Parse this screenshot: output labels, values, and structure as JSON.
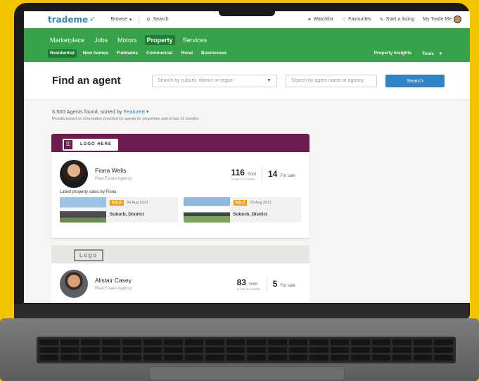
{
  "topbar": {
    "logo": "trademe",
    "browse": "Browse",
    "search": "Search",
    "watchlist": "Watchlist",
    "favourites": "Favourites",
    "start_listing": "Start a listing",
    "my_trademe": "My Trade Me"
  },
  "nav": {
    "main": [
      "Marketplace",
      "Jobs",
      "Motors",
      "Property",
      "Services"
    ],
    "sub": [
      "Residential",
      "New homes",
      "Flatmates",
      "Commercial",
      "Rural",
      "Businesses"
    ],
    "insights": "Property Insights",
    "tools": "Tools"
  },
  "find": {
    "title": "Find an agent",
    "region_placeholder": "Search by suburb, district or region",
    "name_placeholder": "Search by agent name or agency",
    "search_label": "Search"
  },
  "results": {
    "count_text": "6,500 Agents found, sorted by",
    "sort_value": "Featured",
    "note": "Results based on information provided by agents for properties sold in last 12 months."
  },
  "agents": [
    {
      "logo_text": "LOGO HERE",
      "name": "Fiona Wells",
      "agency": "Real Estate Agency",
      "sold": "116",
      "sold_label": "Sold",
      "sold_sub": "in last 12 months",
      "for_sale": "14",
      "for_sale_label": "For sale",
      "latest_label": "Latest property sales by Fiona",
      "sales": [
        {
          "badge": "SOLD",
          "date": "24 Aug 2021",
          "location": "Suburb, District"
        },
        {
          "badge": "SOLD",
          "date": "03 Aug 2021",
          "location": "Suburb, District"
        }
      ]
    },
    {
      "logo_text": "Logo",
      "name": "Alistair Casey",
      "agency": "Real Estate Agency",
      "sold": "83",
      "sold_label": "Sold",
      "sold_sub": "in last 12 months",
      "for_sale": "5",
      "for_sale_label": "For sale"
    }
  ],
  "colors": {
    "brand_green": "#36a24a",
    "brand_blue": "#2f84c6",
    "banner_purple": "#6e1b50",
    "sold_orange": "#f2a11b",
    "background_yellow": "#f2c500"
  }
}
